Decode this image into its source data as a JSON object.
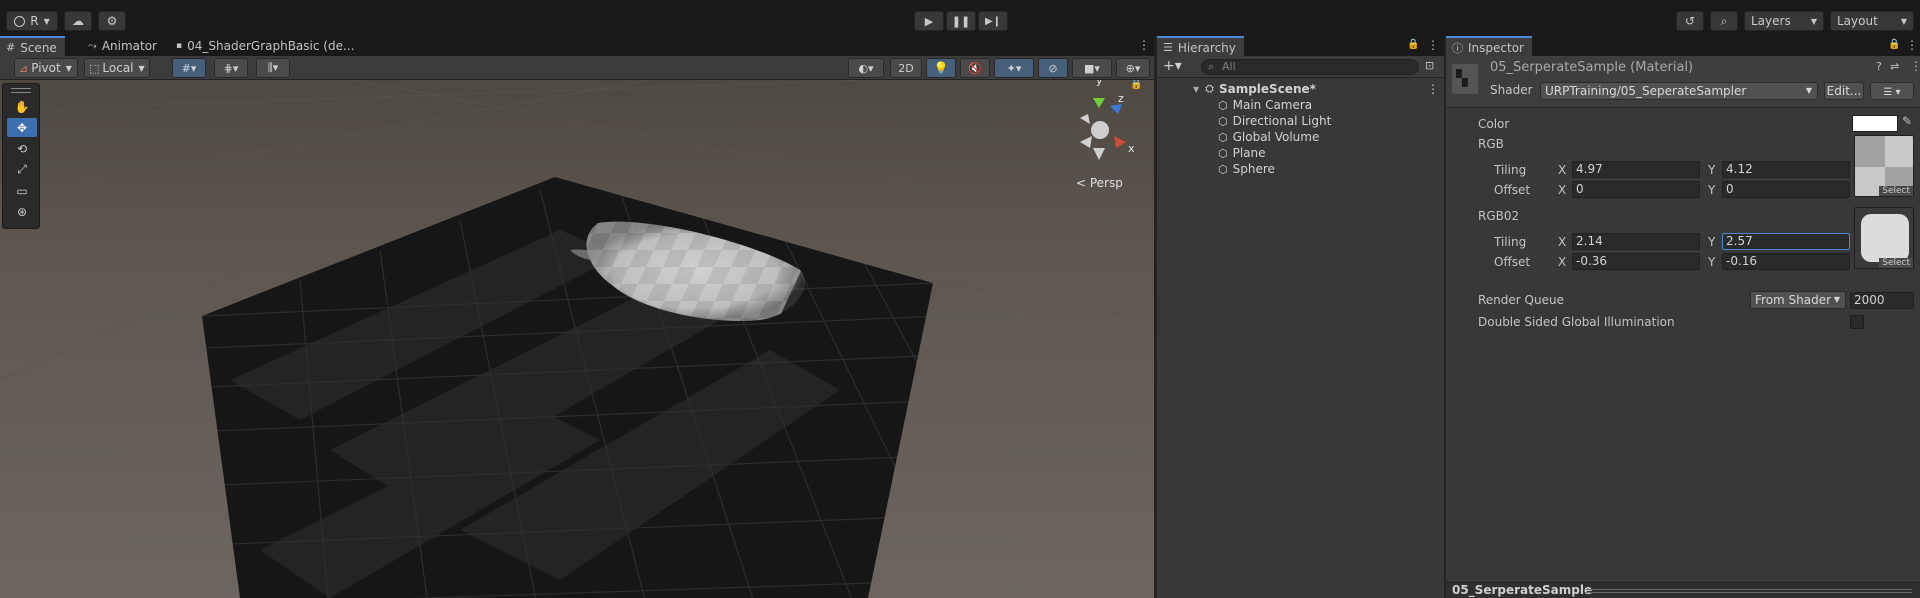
{
  "toolbar": {
    "account_label": "R",
    "layers_label": "Layers",
    "layout_label": "Layout"
  },
  "scene_tabs": [
    {
      "label": "Scene"
    },
    {
      "label": "Animator"
    },
    {
      "label": "04_ShaderGraphBasic (de..."
    }
  ],
  "scene_toolbar": {
    "pivot_label": "Pivot",
    "local_label": "Local",
    "mode_2d_label": "2D"
  },
  "scene_view": {
    "persp_label": "< Persp",
    "axis_y": "y",
    "axis_z": "z",
    "axis_x": "x"
  },
  "hierarchy": {
    "tab_label": "Hierarchy",
    "search_placeholder": "All",
    "scene_name": "SampleScene*",
    "items": [
      {
        "label": "Main Camera"
      },
      {
        "label": "Directional Light"
      },
      {
        "label": "Global Volume"
      },
      {
        "label": "Plane"
      },
      {
        "label": "Sphere"
      }
    ]
  },
  "inspector": {
    "tab_label": "Inspector",
    "material_title": "05_SerperateSample (Material)",
    "shader_label": "Shader",
    "shader_value": "URPTraining/05_SeperateSampler",
    "edit_label": "Edit...",
    "color_label": "Color",
    "rgb": {
      "label": "RGB",
      "tiling_label": "Tiling",
      "offset_label": "Offset",
      "tiling_x": "4.97",
      "tiling_y": "4.12",
      "offset_x": "0",
      "offset_y": "0",
      "select_label": "Select"
    },
    "rgb02": {
      "label": "RGB02",
      "tiling_label": "Tiling",
      "offset_label": "Offset",
      "tiling_x": "2.14",
      "tiling_y": "2.57",
      "offset_x": "-0.36",
      "offset_y": "-0.16",
      "select_label": "Select"
    },
    "x_label": "X",
    "y_label": "Y",
    "render_queue_label": "Render Queue",
    "render_queue_mode": "From Shader",
    "render_queue_value": "2000",
    "double_sided_label": "Double Sided Global Illumination",
    "preview_title": "05_SerperateSample"
  }
}
